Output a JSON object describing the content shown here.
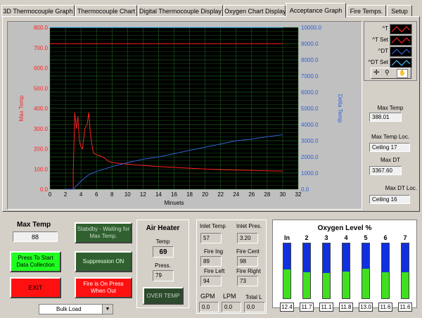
{
  "tabs": [
    {
      "label": "3D Thermocouple Graph"
    },
    {
      "label": "Thermocouple Chart"
    },
    {
      "label": "Digital Thermocouple Display"
    },
    {
      "label": "Oxygen Chart Display"
    },
    {
      "label": "Acceptance Graph"
    },
    {
      "label": "Fire Temps."
    },
    {
      "label": "Setup"
    }
  ],
  "active_tab": "Acceptance Graph",
  "chart_data": {
    "type": "line",
    "xlabel": "Minuets",
    "ylabel": "Max Temp",
    "y2label": "Delta Temp",
    "xlim": [
      0,
      32
    ],
    "ylim": [
      0,
      800
    ],
    "y2lim": [
      0,
      10000
    ],
    "x_ticks": [
      "0",
      "2",
      "4",
      "6",
      "8",
      "10",
      "12",
      "14",
      "16",
      "18",
      "20",
      "22",
      "24",
      "26",
      "28",
      "30",
      "32"
    ],
    "y_ticks": [
      "0.0",
      "100.0",
      "200.0",
      "300.0",
      "400.0",
      "500.0",
      "600.0",
      "700.0",
      "800.0"
    ],
    "y2_ticks": [
      "0.0",
      "1000.0",
      "2000.0",
      "3000.0",
      "4000.0",
      "5000.0",
      "6000.0",
      "7000.0",
      "8000.0",
      "9000.0",
      "10000.0"
    ],
    "grid": true,
    "series": [
      {
        "name": "^T",
        "color": "#ff2020",
        "axis": "left",
        "x": [
          3.0,
          3.0,
          3.2,
          3.4,
          3.6,
          3.8,
          4.0,
          4.2,
          4.5,
          4.8,
          5.0,
          5.2,
          5.4,
          5.6,
          6.0,
          6.5,
          7.0,
          7.5,
          8,
          9,
          10,
          12,
          14,
          16,
          18,
          20,
          22,
          24,
          26,
          28,
          30
        ],
        "y": [
          0,
          80,
          380,
          300,
          360,
          240,
          210,
          200,
          300,
          320,
          380,
          280,
          220,
          180,
          170,
          165,
          155,
          140,
          132,
          128,
          124,
          118,
          112,
          108,
          104,
          100,
          97,
          95,
          93,
          91,
          90
        ]
      },
      {
        "name": "^T Set",
        "color": "#ff2020",
        "axis": "left",
        "x": [
          0,
          30
        ],
        "y": [
          720,
          720
        ]
      },
      {
        "name": "^DT",
        "color": "#3060d0",
        "axis": "right",
        "x": [
          2.0,
          3.0,
          4.0,
          5.0,
          6.0,
          8,
          10,
          12,
          14,
          16,
          18,
          20,
          22,
          24,
          26,
          28,
          30
        ],
        "y": [
          0,
          0,
          500,
          900,
          1100,
          1400,
          1650,
          1850,
          2000,
          2200,
          2400,
          2600,
          2800,
          3000,
          3100,
          3250,
          3367.6
        ]
      },
      {
        "name": "^DT Set",
        "color": "#40c0ff",
        "axis": "right",
        "x": [
          0,
          30
        ],
        "y": [
          10000,
          10000
        ]
      }
    ]
  },
  "legend": [
    {
      "label": "^T",
      "color": "#ff2020"
    },
    {
      "label": "^T Set",
      "color": "#ff2020"
    },
    {
      "label": "^DT",
      "color": "#3060d0"
    },
    {
      "label": "^DT Set",
      "color": "#40c0ff"
    }
  ],
  "stats": {
    "max_temp_label": "Max Temp",
    "max_temp_value": "388.01",
    "max_temp_loc_label": "Max Temp Loc.",
    "max_temp_loc_value": "Ceiling 17",
    "max_dt_label": "Max DT",
    "max_dt_value": "3367.60",
    "max_dt_loc_label": "Max DT Loc.",
    "max_dt_loc_value": "Ceiling 16"
  },
  "controls": {
    "max_temp_label": "Max Temp",
    "max_temp_value": "88",
    "start_btn": "Press To Start Data Collection",
    "exit_btn": "EXIT",
    "standby_btn": "Stabdby - Waiting for Max Temp.",
    "suppression_btn": "Suppression ON",
    "fire_btn": "Fire is On Press When Out",
    "load_select": "Bulk Load"
  },
  "air_heater": {
    "title": "Air Heater",
    "temp_label": "Temp",
    "temp_value": "69",
    "press_label": "Press.",
    "press_value": "79",
    "over_temp_btn": "OVER TEMP"
  },
  "inlet": {
    "inlet_temp_label": "Inlet Temp",
    "inlet_temp_value": "57",
    "inlet_pres_label": "Inlet Pres.",
    "inlet_pres_value": "3.20",
    "fire_ing_label": "Fire Ing",
    "fire_ing_value": "89",
    "fire_cent_label": "Fire Cent",
    "fire_cent_value": "98",
    "fire_left_label": "Fire Left",
    "fire_left_value": "94",
    "fire_right_label": "Fire Right",
    "fire_right_value": "73",
    "gpm_label": "GPM",
    "gpm_value": "0.0",
    "lpm_label": "LPM",
    "lpm_value": "0.0",
    "total_label": "Total L",
    "total_value": "0.0"
  },
  "oxygen": {
    "title": "Oxygen Level %",
    "columns": [
      {
        "label": "In",
        "value": "12.4",
        "level": 0.52
      },
      {
        "label": "2",
        "value": "11.7",
        "level": 0.48
      },
      {
        "label": "3",
        "value": "11.1",
        "level": 0.46
      },
      {
        "label": "4",
        "value": "11.8",
        "level": 0.49
      },
      {
        "label": "5",
        "value": "13.0",
        "level": 0.54
      },
      {
        "label": "6",
        "value": "11.6",
        "level": 0.48
      },
      {
        "label": "7",
        "value": "11.6",
        "level": 0.48
      }
    ]
  }
}
